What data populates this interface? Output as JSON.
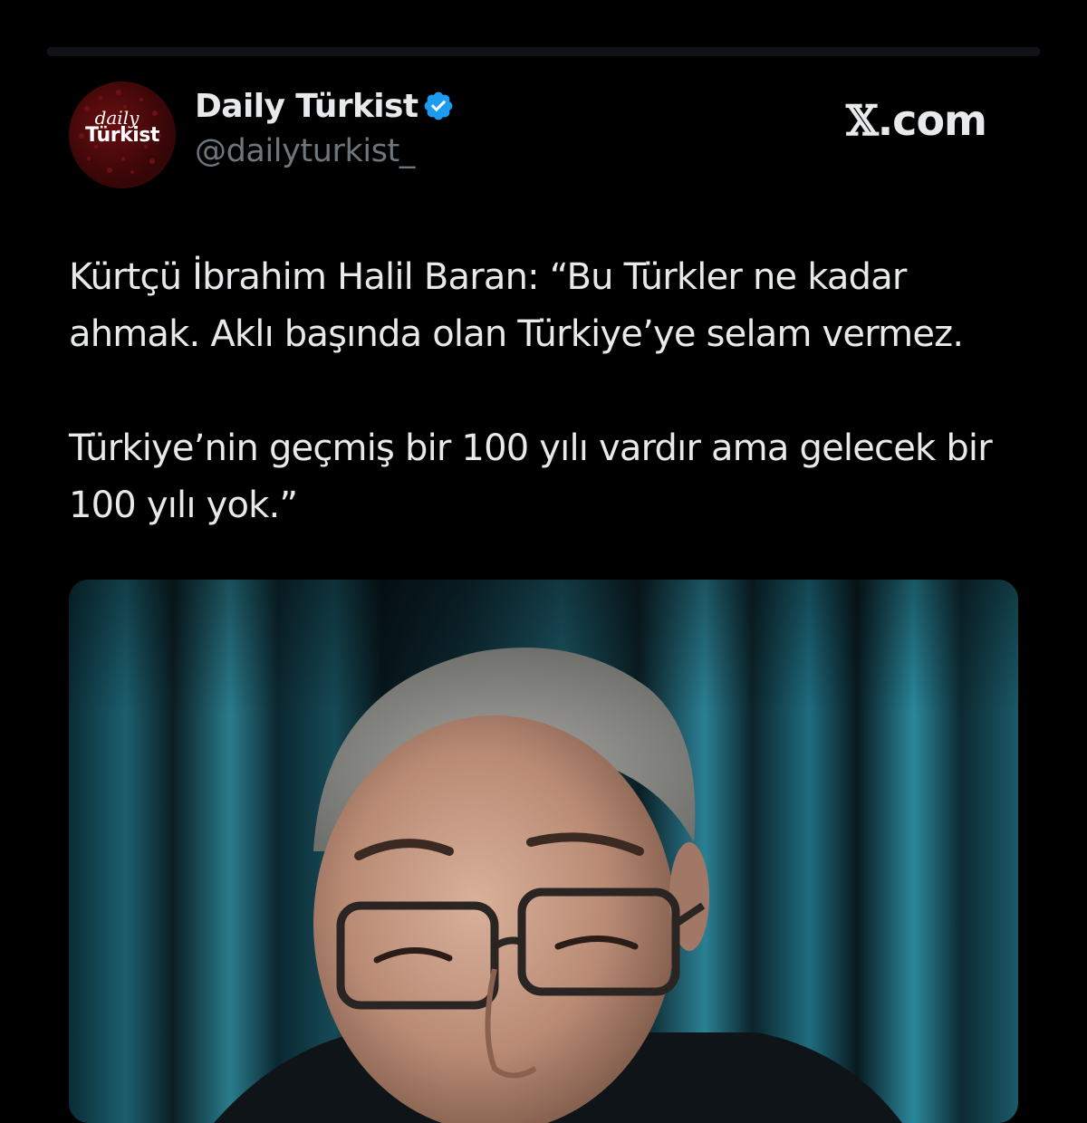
{
  "tweet": {
    "author_name": "Daily Türkist",
    "handle": "@dailyturkist_",
    "verified": true,
    "avatar_logo": {
      "line1": "daily",
      "line2": "Türkist"
    },
    "source_brand": {
      "x": "𝕏",
      "domain": ".com"
    },
    "paragraphs": [
      "Kürtçü İbrahim Halil Baran: “Bu Türkler ne kadar ahmak. Aklı başında olan Türkiye’ye selam vermez.",
      "Türkiye’nin geçmiş bir 100 yılı vardır ama gelecek bir 100 yılı yok.”"
    ],
    "media": {
      "kind": "video-still",
      "subject": "person-with-glasses-icon"
    }
  },
  "colors": {
    "background": "#000000",
    "text": "#e7e9ea",
    "secondary_text": "#6e767d",
    "verified_badge": "#1d9bf0",
    "avatar_red": "#5a0b0d"
  },
  "icons": [
    "verified-badge-icon",
    "x-logo-icon"
  ]
}
